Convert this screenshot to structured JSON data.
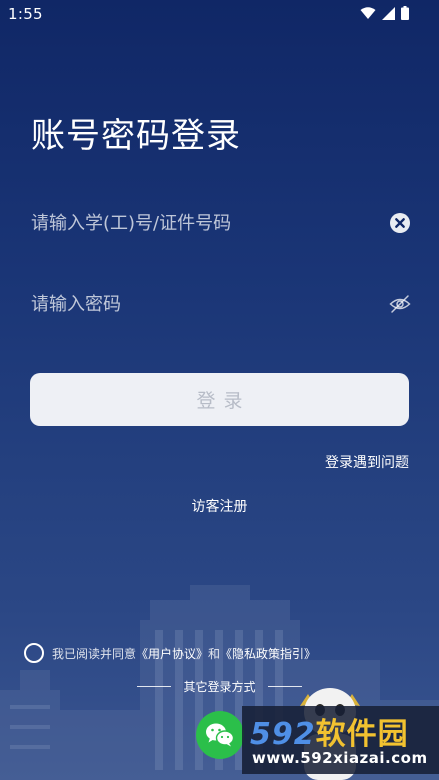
{
  "status_bar": {
    "time": "1:55",
    "icons": [
      "wifi-icon",
      "signal-icon",
      "battery-icon"
    ]
  },
  "login": {
    "title": "账号密码登录",
    "account_placeholder": "请输入学(工)号/证件号码",
    "password_placeholder": "请输入密码",
    "submit_label": "登录",
    "problem_link": "登录遇到问题",
    "guest_link": "访客注册"
  },
  "agreement": {
    "prefix": "我已阅读并同意",
    "user_agreement": "《用户协议》",
    "conjunction": "和",
    "privacy_policy": "《隐私政策指引》",
    "checked": false
  },
  "other_login": {
    "label": "其它登录方式",
    "wechat_icon": "wechat-icon"
  },
  "watermark": {
    "logo_number": "592",
    "logo_text": "软件园",
    "url": "www.592xiazai.com"
  },
  "colors": {
    "background_top": "#102766",
    "background_bottom": "#3a5590",
    "button_bg": "#eef0f5",
    "button_text": "#b7bcc7",
    "wechat_green": "#2bbf4a",
    "watermark_blue": "#4f8fe6",
    "watermark_yellow": "#f2c230"
  }
}
